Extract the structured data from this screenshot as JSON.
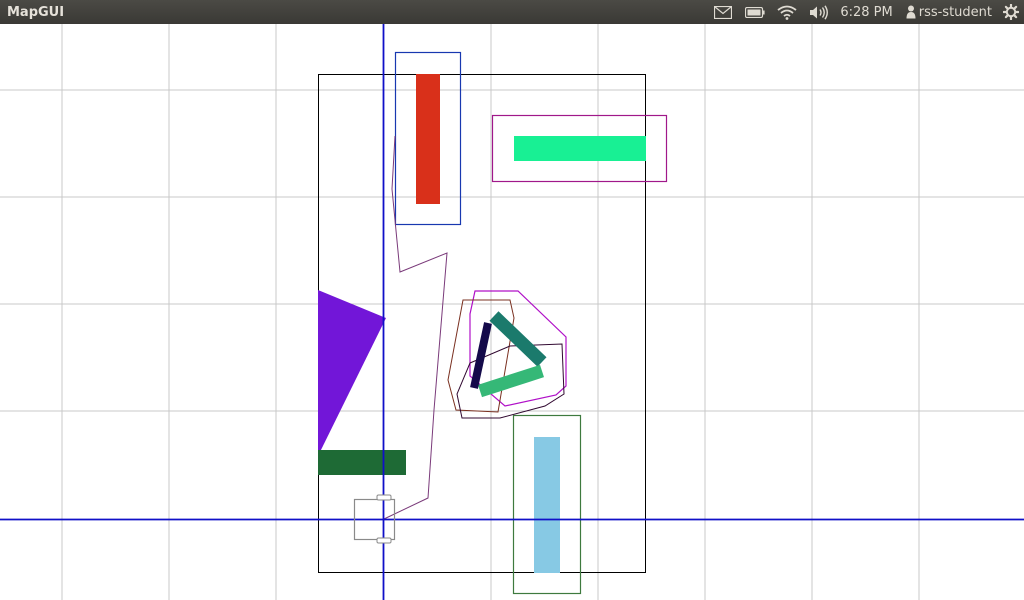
{
  "app": {
    "title": "MapGUI"
  },
  "panel": {
    "clock": "6:28 PM",
    "user": "rss-student",
    "icons": [
      "mail-icon",
      "battery-icon",
      "wifi-icon",
      "volume-icon",
      "user-icon",
      "gear-icon"
    ]
  },
  "colors": {
    "panel_bg": "#3c3b37",
    "panel_text": "#dfdbd2",
    "grid": "#c8c8c8",
    "axes": "#1010c8",
    "world_boundary": "#000000",
    "red_obstacle": "#d9301a",
    "mint_obstacle": "#18f094",
    "violet_obstacle": "#7216d8",
    "dark_green_obstacle": "#1e6a35",
    "light_blue_obstacle": "#87c9e4",
    "navy_obstacle": "#140a4a",
    "teal_obstacle": "#1b7a6c",
    "sea_green_obstacle": "#35b877",
    "path": "#7a3a7a"
  }
}
